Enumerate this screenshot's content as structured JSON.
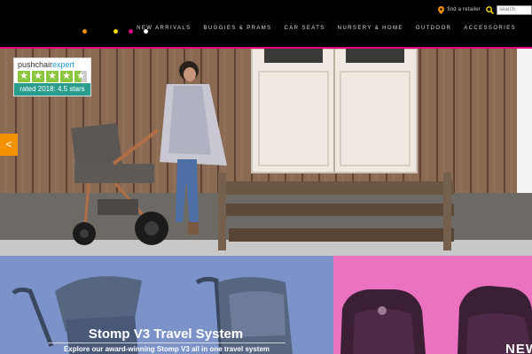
{
  "header": {
    "store_finder": "find a retailer",
    "search_placeholder": "search",
    "nav": [
      "new arrivals",
      "buggies & prams",
      "car seats",
      "nursery & home",
      "outdoor",
      "accessories"
    ],
    "logo_dots": [
      "#f39200",
      "#ffdd00",
      "#e6007e",
      "#ffffff"
    ],
    "accent_color": "#e6007e"
  },
  "hero": {
    "badge": {
      "brand_plain": "pushchair",
      "brand_accent": "expert",
      "stars": [
        "★",
        "★",
        "★",
        "★",
        "★"
      ],
      "rating": "4.5",
      "rating_text": "rated 2018: 4.5 stars"
    },
    "prev_arrow": "<"
  },
  "tiles": {
    "blue": {
      "title": "Stomp V3 Travel System",
      "subtitle": "Explore our award-winning Stomp V3 all in one travel system",
      "color": "#7b93c8"
    },
    "pink": {
      "label": "NEW",
      "color": "#ea72c1"
    }
  }
}
